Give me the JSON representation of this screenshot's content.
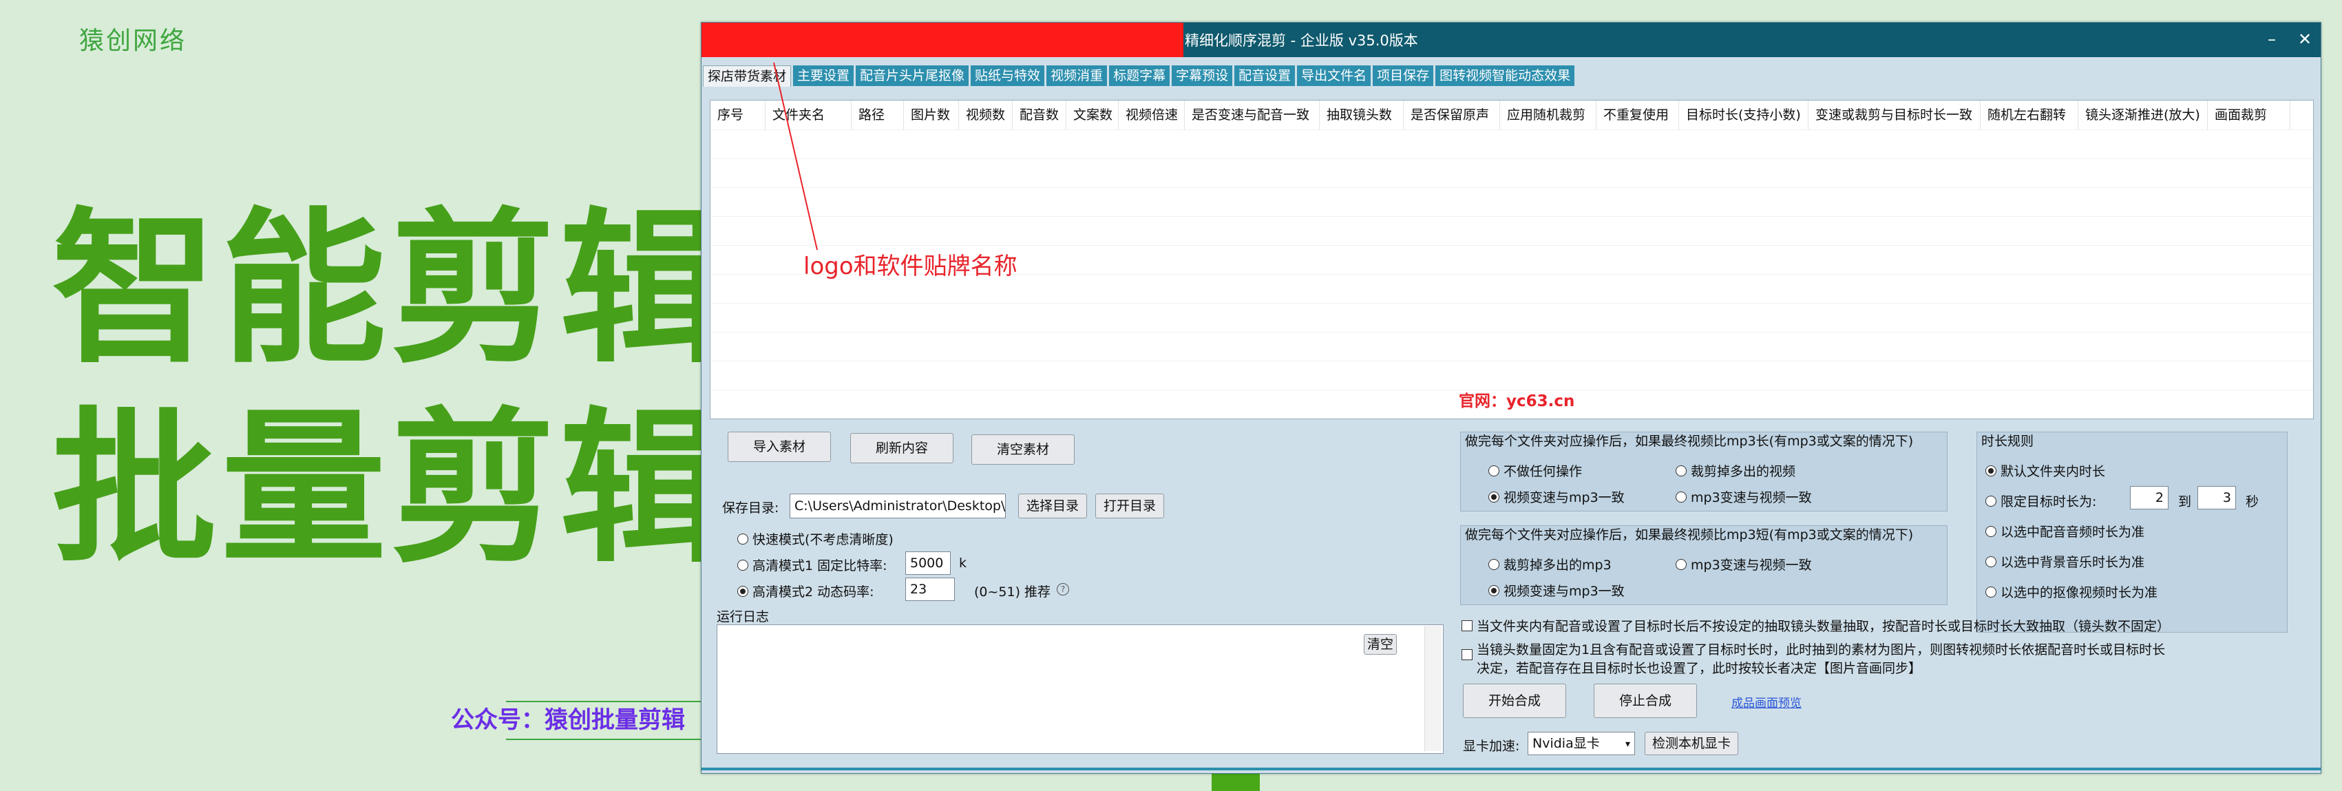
{
  "promo": {
    "brand": "猿创网络",
    "headline1": "智能剪辑",
    "headline2": "批量剪辑",
    "wechat": "公众号：猿创批量剪辑"
  },
  "window": {
    "title": "精细化顺序混剪 - 企业版  v35.0版本",
    "minimize": "–",
    "close": "✕"
  },
  "tabs": [
    "探店带货素材",
    "主要设置",
    "配音片头片尾抠像",
    "贴纸与特效",
    "视频消重",
    "标题字幕",
    "字幕预设",
    "配音设置",
    "导出文件名",
    "项目保存",
    "图转视频智能动态效果"
  ],
  "table": {
    "columns": [
      "序号",
      "文件夹名",
      "路径",
      "图片数",
      "视频数",
      "配音数",
      "文案数",
      "视频倍速",
      "是否变速与配音一致",
      "抽取镜头数",
      "是否保留原声",
      "应用随机裁剪",
      "不重复使用",
      "目标时长(支持小数)",
      "变速或裁剪与目标时长一致",
      "随机左右翻转",
      "镜头逐渐推进(放大)",
      "画面裁剪"
    ],
    "rows": []
  },
  "annotation": {
    "logo_note": "logo和软件贴牌名称",
    "site": "官网：yc63.cn"
  },
  "buttons": {
    "import": "导入素材",
    "refresh": "刷新内容",
    "clear_material": "清空素材",
    "choose_dir": "选择目录",
    "open_dir": "打开目录",
    "start": "开始合成",
    "stop": "停止合成",
    "clear_log": "清空",
    "detect_gpu": "检测本机显卡"
  },
  "save": {
    "label": "保存目录:",
    "path": "C:\\Users\\Administrator\\Desktop\\新建"
  },
  "quality": {
    "fast": "快速模式(不考虑清晰度)",
    "hd1": "高清模式1 固定比特率:",
    "hd1_value": "5000",
    "hd1_unit": "k",
    "hd2": "高清模式2 动态码率:",
    "hd2_value": "23",
    "hd2_range": "(0~51)  推荐",
    "selected": "hd2"
  },
  "log": {
    "label": "运行日志"
  },
  "panel_long": {
    "title": "做完每个文件夹对应操作后，如果最终视频比mp3长(有mp3或文案的情况下)",
    "opt1": "不做任何操作",
    "opt2": "裁剪掉多出的视频",
    "opt3": "视频变速与mp3一致",
    "opt4": "mp3变速与视频一致",
    "selected": "opt3"
  },
  "panel_short": {
    "title": "做完每个文件夹对应操作后，如果最终视频比mp3短(有mp3或文案的情况下)",
    "opt1": "裁剪掉多出的mp3",
    "opt2": "mp3变速与视频一致",
    "opt3": "视频变速与mp3一致",
    "selected": "opt3"
  },
  "duration": {
    "title": "时长规则",
    "opt1": "默认文件夹内时长",
    "opt2": "限定目标时长为:",
    "from": "2",
    "to_label": "到",
    "to": "3",
    "unit": "秒",
    "opt3": "以选中配音音频时长为准",
    "opt4": "以选中背景音乐时长为准",
    "opt5": "以选中的抠像视频时长为准",
    "selected": "opt1"
  },
  "checks": {
    "c1": "当文件夹内有配音或设置了目标时长后不按设定的抽取镜头数量抽取，按配音时长或目标时长大致抽取（镜头数不固定）",
    "c2a": "当镜头数量固定为1且含有配音或设置了目标时长时，此时抽到的素材为图片，则图转视频时长依据配音时长或目标时长",
    "c2b": "决定，若配音存在且目标时长也设置了，此时按较长者决定【图片音画同步】"
  },
  "link": "成品画面预览",
  "gpu": {
    "label": "显卡加速:",
    "value": "Nvidia显卡"
  },
  "colors": {
    "accent": "#0f5a6e",
    "tab": "#2d8fae",
    "headline": "#47a01a",
    "logo_block": "#ff1a1a"
  }
}
